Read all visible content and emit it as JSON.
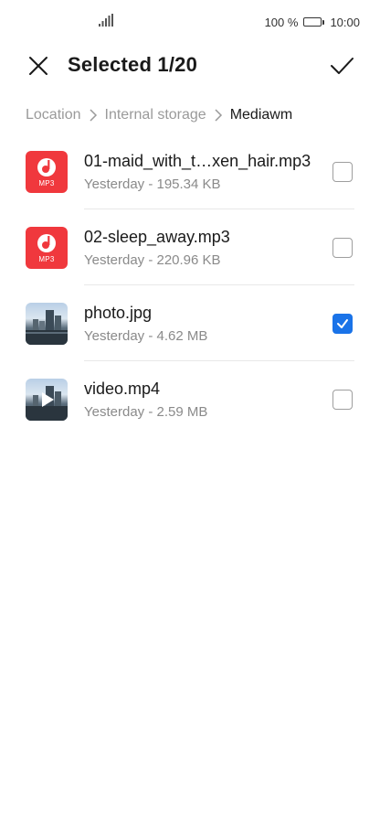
{
  "status_bar": {
    "battery_text": "100 %",
    "time": "10:00",
    "icons": [
      "signal-icon",
      "battery-icon"
    ]
  },
  "header": {
    "title": "Selected 1/20",
    "icons": [
      "close-icon",
      "checkmark-icon"
    ]
  },
  "breadcrumb": {
    "items": [
      "Location",
      "Internal storage",
      "Mediawm"
    ],
    "separator_icon": "chevron-right-icon"
  },
  "files": [
    {
      "name": "01-maid_with_t…xen_hair.mp3",
      "details": "Yesterday - 195.34 KB",
      "thumbnail": "mp3-icon",
      "thumbnail_label": "MP3",
      "checked": false
    },
    {
      "name": "02-sleep_away.mp3",
      "details": "Yesterday - 220.96 KB",
      "thumbnail": "mp3-icon",
      "thumbnail_label": "MP3",
      "checked": false
    },
    {
      "name": "photo.jpg",
      "details": "Yesterday - 4.62 MB",
      "thumbnail": "photo-thumbnail",
      "checked": true
    },
    {
      "name": "video.mp4",
      "details": "Yesterday - 2.59 MB",
      "thumbnail": "video-thumbnail",
      "checked": false
    }
  ],
  "colors": {
    "accent": "#1a73e8",
    "mp3_red": "#f0383d",
    "secondary_text": "#8a8a8a"
  }
}
